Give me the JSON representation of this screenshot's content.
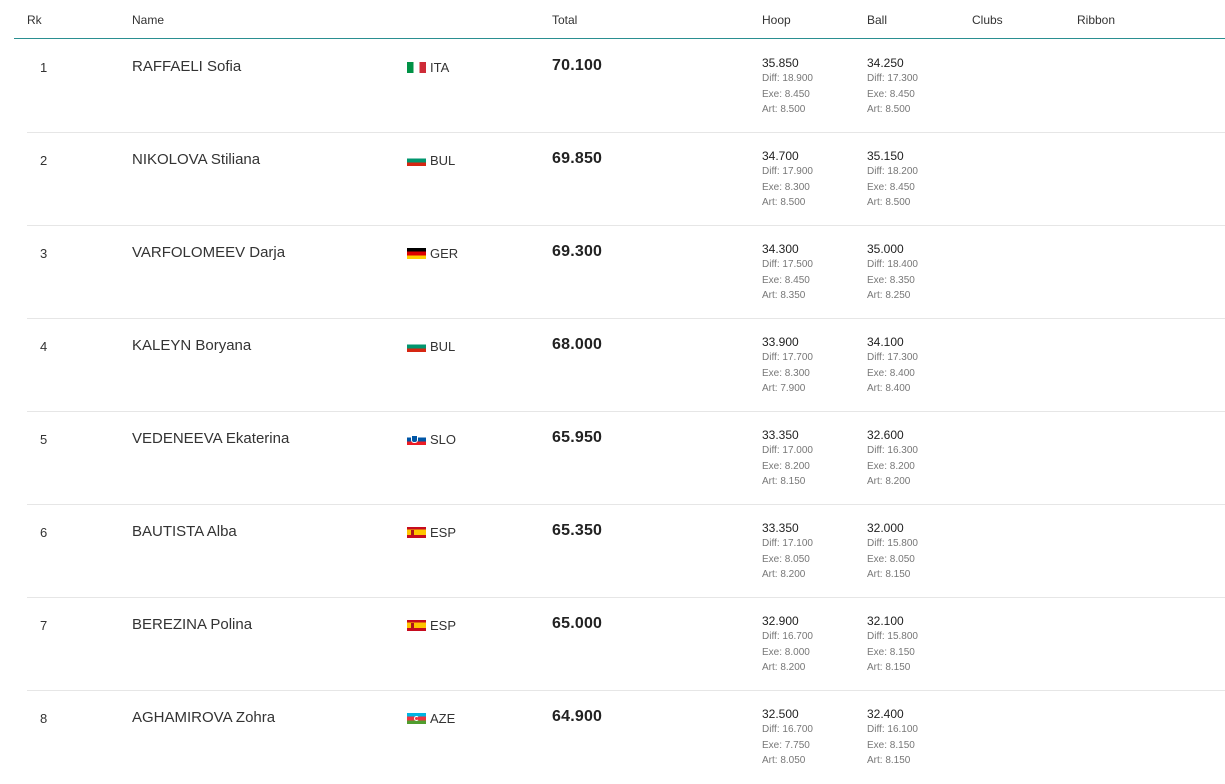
{
  "columns": {
    "rk": "Rk",
    "name": "Name",
    "total": "Total",
    "hoop": "Hoop",
    "ball": "Ball",
    "clubs": "Clubs",
    "ribbon": "Ribbon"
  },
  "rows": [
    {
      "rk": "1",
      "name": "RAFFAELI Sofia",
      "nat": "ITA",
      "flag": "ita-flag",
      "total": "70.100",
      "hoop": {
        "score": "35.850",
        "diff": "Diff: 18.900",
        "exe": "Exe: 8.450",
        "art": "Art: 8.500"
      },
      "ball": {
        "score": "34.250",
        "diff": "Diff: 17.300",
        "exe": "Exe: 8.450",
        "art": "Art: 8.500"
      }
    },
    {
      "rk": "2",
      "name": "NIKOLOVA Stiliana",
      "nat": "BUL",
      "flag": "bul-flag",
      "total": "69.850",
      "hoop": {
        "score": "34.700",
        "diff": "Diff: 17.900",
        "exe": "Exe: 8.300",
        "art": "Art: 8.500"
      },
      "ball": {
        "score": "35.150",
        "diff": "Diff: 18.200",
        "exe": "Exe: 8.450",
        "art": "Art: 8.500"
      }
    },
    {
      "rk": "3",
      "name": "VARFOLOMEEV Darja",
      "nat": "GER",
      "flag": "ger-flag",
      "total": "69.300",
      "hoop": {
        "score": "34.300",
        "diff": "Diff: 17.500",
        "exe": "Exe: 8.450",
        "art": "Art: 8.350"
      },
      "ball": {
        "score": "35.000",
        "diff": "Diff: 18.400",
        "exe": "Exe: 8.350",
        "art": "Art: 8.250"
      }
    },
    {
      "rk": "4",
      "name": "KALEYN Boryana",
      "nat": "BUL",
      "flag": "bul-flag",
      "total": "68.000",
      "hoop": {
        "score": "33.900",
        "diff": "Diff: 17.700",
        "exe": "Exe: 8.300",
        "art": "Art: 7.900"
      },
      "ball": {
        "score": "34.100",
        "diff": "Diff: 17.300",
        "exe": "Exe: 8.400",
        "art": "Art: 8.400"
      }
    },
    {
      "rk": "5",
      "name": "VEDENEEVA Ekaterina",
      "nat": "SLO",
      "flag": "slo-flag",
      "total": "65.950",
      "hoop": {
        "score": "33.350",
        "diff": "Diff: 17.000",
        "exe": "Exe: 8.200",
        "art": "Art: 8.150"
      },
      "ball": {
        "score": "32.600",
        "diff": "Diff: 16.300",
        "exe": "Exe: 8.200",
        "art": "Art: 8.200"
      }
    },
    {
      "rk": "6",
      "name": "BAUTISTA Alba",
      "nat": "ESP",
      "flag": "esp-flag",
      "total": "65.350",
      "hoop": {
        "score": "33.350",
        "diff": "Diff: 17.100",
        "exe": "Exe: 8.050",
        "art": "Art: 8.200"
      },
      "ball": {
        "score": "32.000",
        "diff": "Diff: 15.800",
        "exe": "Exe: 8.050",
        "art": "Art: 8.150"
      }
    },
    {
      "rk": "7",
      "name": "BEREZINA Polina",
      "nat": "ESP",
      "flag": "esp-flag",
      "total": "65.000",
      "hoop": {
        "score": "32.900",
        "diff": "Diff: 16.700",
        "exe": "Exe: 8.000",
        "art": "Art: 8.200"
      },
      "ball": {
        "score": "32.100",
        "diff": "Diff: 15.800",
        "exe": "Exe: 8.150",
        "art": "Art: 8.150"
      }
    },
    {
      "rk": "8",
      "name": "AGHAMIROVA Zohra",
      "nat": "AZE",
      "flag": "aze-flag",
      "total": "64.900",
      "hoop": {
        "score": "32.500",
        "diff": "Diff: 16.700",
        "exe": "Exe: 7.750",
        "art": "Art: 8.050"
      },
      "ball": {
        "score": "32.400",
        "diff": "Diff: 16.100",
        "exe": "Exe: 8.150",
        "art": "Art: 8.150"
      }
    }
  ]
}
